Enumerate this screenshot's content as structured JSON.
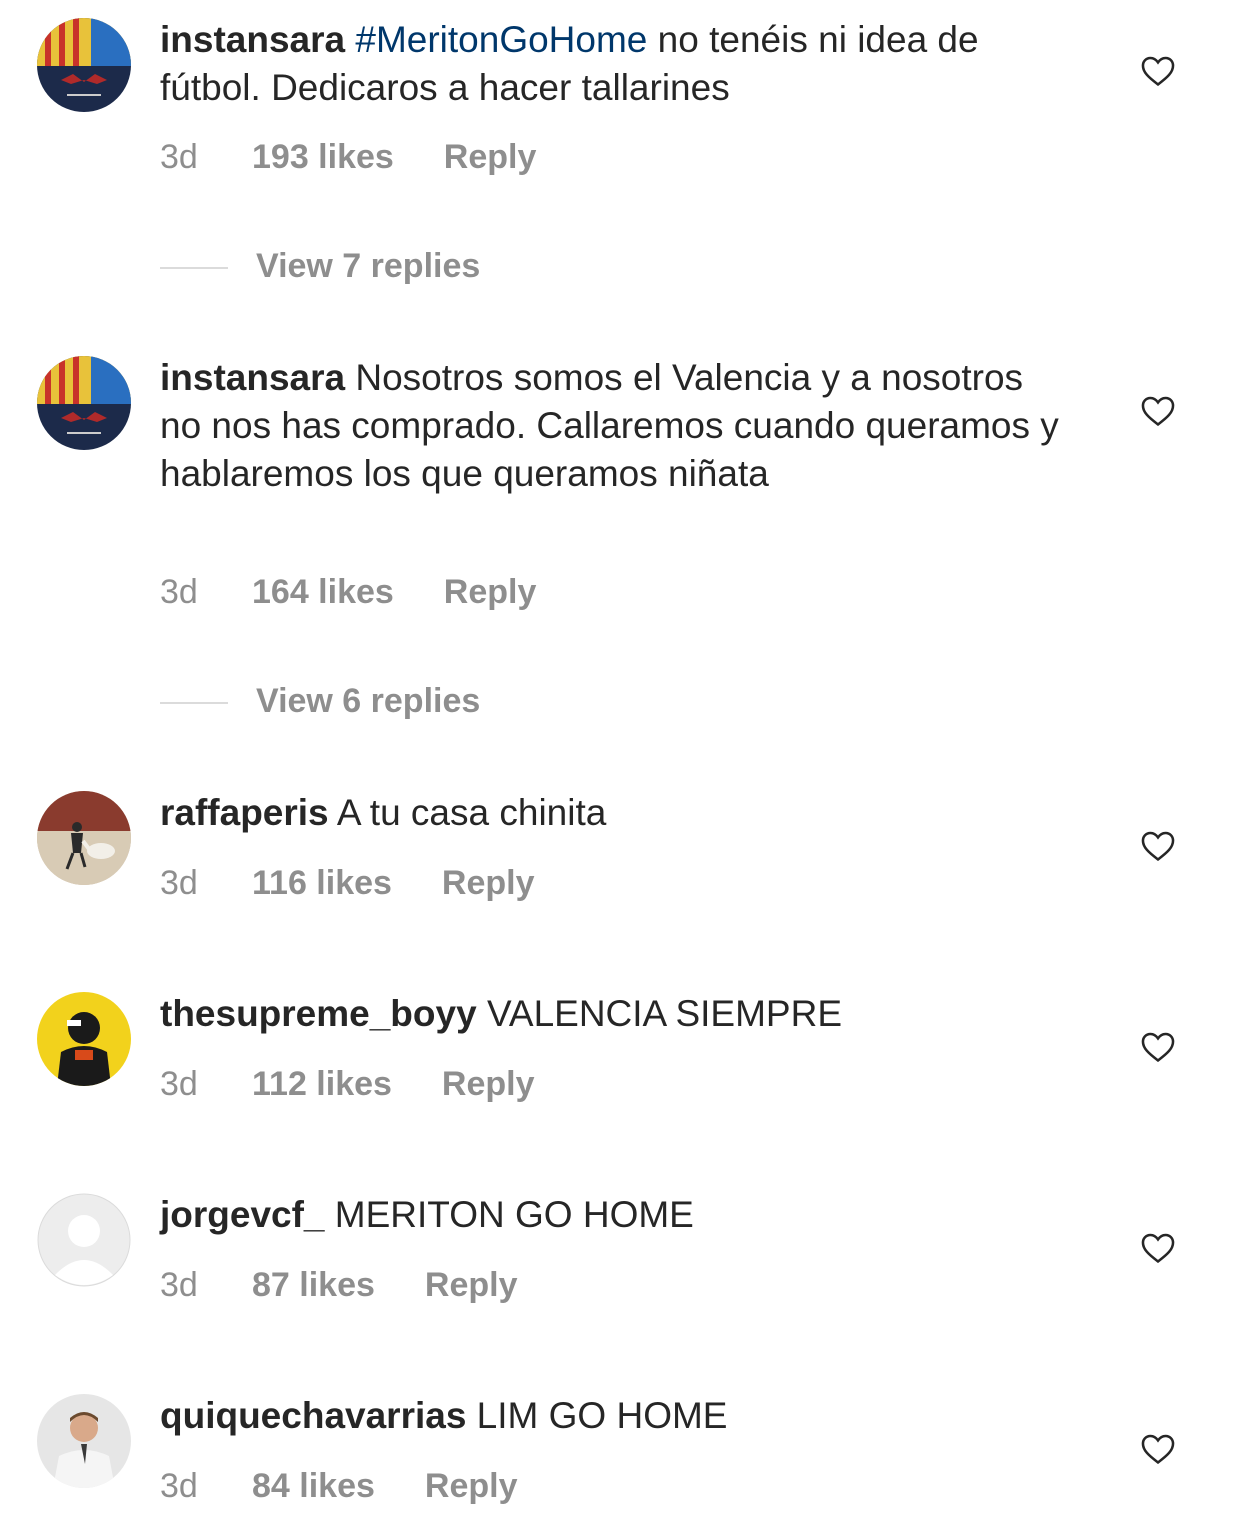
{
  "comments": [
    {
      "username": "instansara",
      "hashtag": "#MeritonGoHome",
      "text": " no tenéis ni idea de fútbol. Dedicaros a hacer tallarines",
      "time": "3d",
      "likes": "193 likes",
      "reply": "Reply",
      "view_replies": "View 7 replies"
    },
    {
      "username": "instansara",
      "text": " Nosotros somos el Valencia y a nosotros no nos has comprado. Callaremos cuando queramos y hablaremos los que queramos niñata",
      "time": "3d",
      "likes": "164 likes",
      "reply": "Reply",
      "view_replies": "View 6 replies"
    },
    {
      "username": "raffaperis",
      "text": " A tu casa chinita",
      "time": "3d",
      "likes": "116 likes",
      "reply": "Reply"
    },
    {
      "username": "thesupreme_boyy",
      "text": " VALENCIA SIEMPRE",
      "time": "3d",
      "likes": "112 likes",
      "reply": "Reply"
    },
    {
      "username": "jorgevcf_",
      "text": " MERITON GO HOME",
      "time": "3d",
      "likes": "87 likes",
      "reply": "Reply"
    },
    {
      "username": "quiquechavarrias",
      "text": " LIM GO HOME",
      "time": "3d",
      "likes": "84 likes",
      "reply": "Reply"
    }
  ],
  "colors": {
    "text": "#262626",
    "secondary": "#8e8e8e",
    "hashtag": "#00376b",
    "divider": "#dbdbdb"
  }
}
